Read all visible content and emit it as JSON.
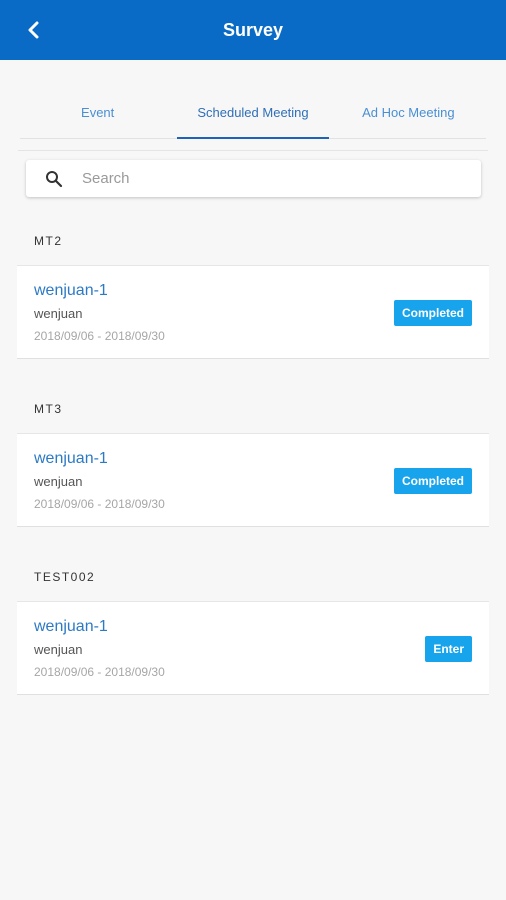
{
  "header": {
    "title": "Survey",
    "back_icon": "chevron-left-icon",
    "background_color": "#0a6bc7"
  },
  "tabs": [
    {
      "label": "Event",
      "active": false
    },
    {
      "label": "Scheduled Meeting",
      "active": true
    },
    {
      "label": "Ad Hoc Meeting",
      "active": false
    }
  ],
  "search": {
    "placeholder": "Search",
    "value": "",
    "icon": "search-icon"
  },
  "groups": [
    {
      "label": "MT2",
      "item": {
        "title": "wenjuan-1",
        "subtitle": "wenjuan",
        "date_range": "2018/09/06 - 2018/09/30",
        "status": "Completed"
      }
    },
    {
      "label": "MT3",
      "item": {
        "title": "wenjuan-1",
        "subtitle": "wenjuan",
        "date_range": "2018/09/06 - 2018/09/30",
        "status": "Completed"
      }
    },
    {
      "label": "TEST002",
      "item": {
        "title": "wenjuan-1",
        "subtitle": "wenjuan",
        "date_range": "2018/09/06 - 2018/09/30",
        "status": "Enter"
      }
    }
  ],
  "colors": {
    "accent": "#17a4ec",
    "link": "#2c7ac4"
  }
}
